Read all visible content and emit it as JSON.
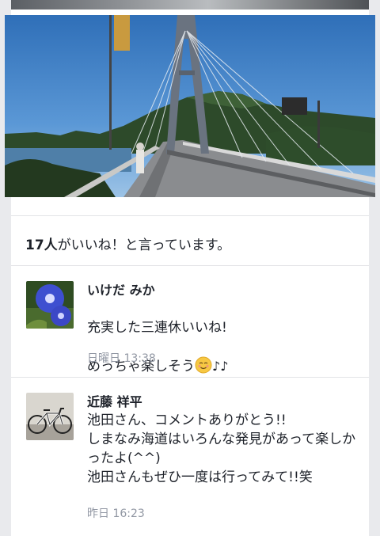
{
  "likes": {
    "count": "17人",
    "suffix": "がいいね！と言っています。"
  },
  "comments": [
    {
      "author": "いけだ みか",
      "line1": "充実した三連休いいね!",
      "line2_text": "めっちゃ楽しそう",
      "line2_notes": "♪♪",
      "time": "日曜日 13:38",
      "avatar_icon": "morning-glory-flower-photo"
    },
    {
      "author": "近藤 祥平",
      "body": "池田さん、コメントありがとう!!\nしまなみ海道はいろんな発見があって楽しかったよ(^^)\n池田さんもぜひ一度は行ってみて!!笑",
      "time": "昨日 16:23",
      "avatar_icon": "road-bicycle-photo"
    }
  ],
  "colors": {
    "background": "#e9eaed",
    "text": "#1d2129",
    "timestamp": "#9197a3"
  }
}
